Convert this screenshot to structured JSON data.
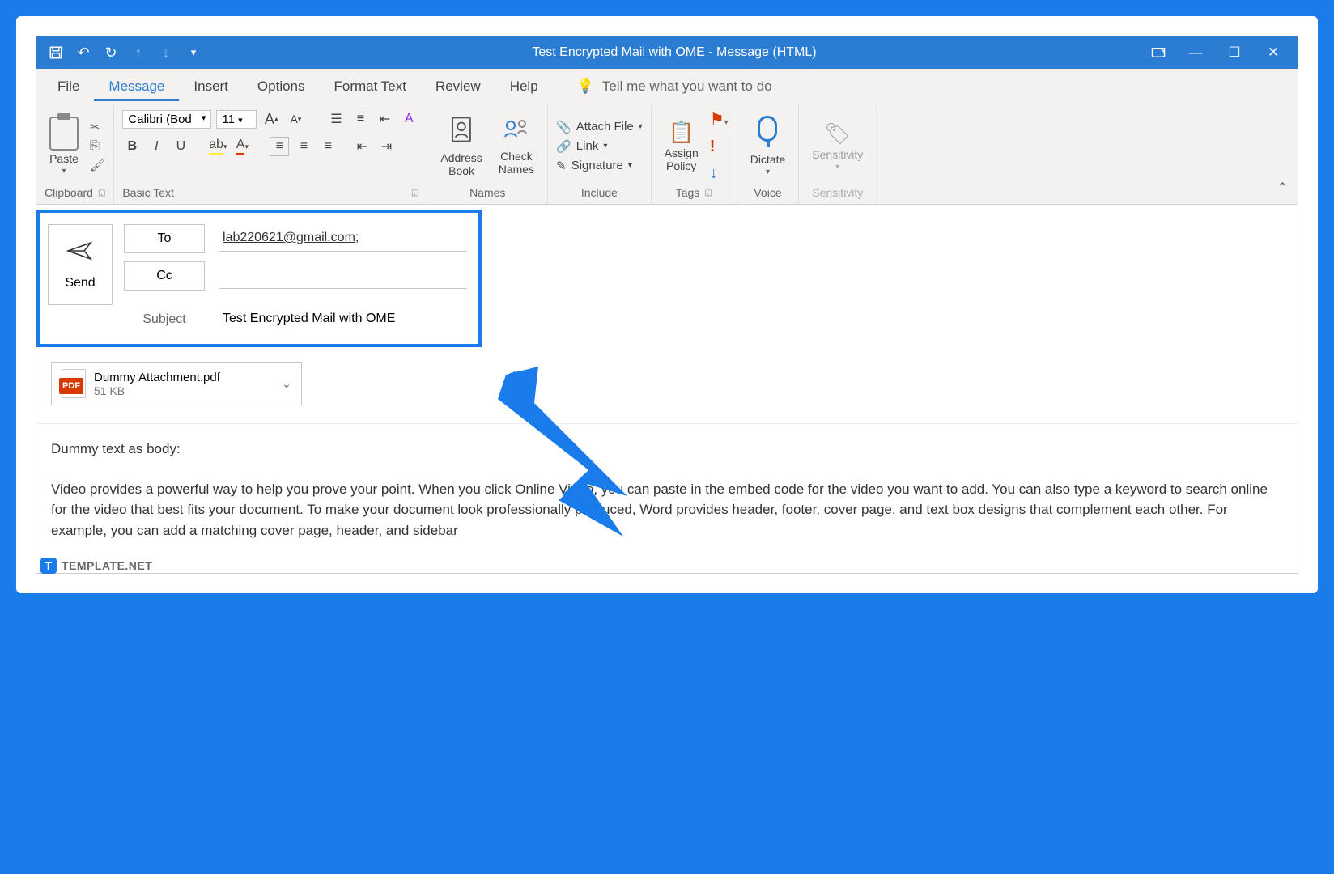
{
  "titlebar": {
    "title": "Test Encrypted Mail with OME  -  Message (HTML)"
  },
  "menu": {
    "file": "File",
    "message": "Message",
    "insert": "Insert",
    "options": "Options",
    "format_text": "Format Text",
    "review": "Review",
    "help": "Help",
    "tellme": "Tell me what you want to do"
  },
  "ribbon": {
    "clipboard": {
      "label": "Clipboard",
      "paste": "Paste"
    },
    "basic_text": {
      "label": "Basic Text",
      "font": "Calibri (Bod",
      "size": "11"
    },
    "names": {
      "label": "Names",
      "address_book": "Address\nBook",
      "check_names": "Check\nNames"
    },
    "include": {
      "label": "Include",
      "attach_file": "Attach File",
      "link": "Link",
      "signature": "Signature"
    },
    "tags": {
      "label": "Tags",
      "assign_policy": "Assign\nPolicy"
    },
    "voice": {
      "label": "Voice",
      "dictate": "Dictate"
    },
    "sensitivity": {
      "label": "Sensitivity",
      "sensitivity_btn": "Sensitivity"
    }
  },
  "compose": {
    "send": "Send",
    "to_label": "To",
    "to_value": "lab220621@gmail.com;",
    "cc_label": "Cc",
    "cc_value": "",
    "subject_label": "Subject",
    "subject_value": "Test Encrypted Mail with OME"
  },
  "attachment": {
    "name": "Dummy Attachment.pdf",
    "size": "51 KB",
    "badge": "PDF"
  },
  "body": {
    "intro": "Dummy text as body:",
    "para": "Video provides a powerful way to help you prove your point. When you click Online Video, you can paste in the embed code for the video you want to add. You can also type a keyword to search online for the video that best fits your document. To make your document look professionally produced, Word provides header, footer, cover page, and text box designs that complement each other. For example, you can add a matching cover page, header, and sidebar"
  },
  "brand": {
    "name": "TEMPLATE.NET"
  }
}
